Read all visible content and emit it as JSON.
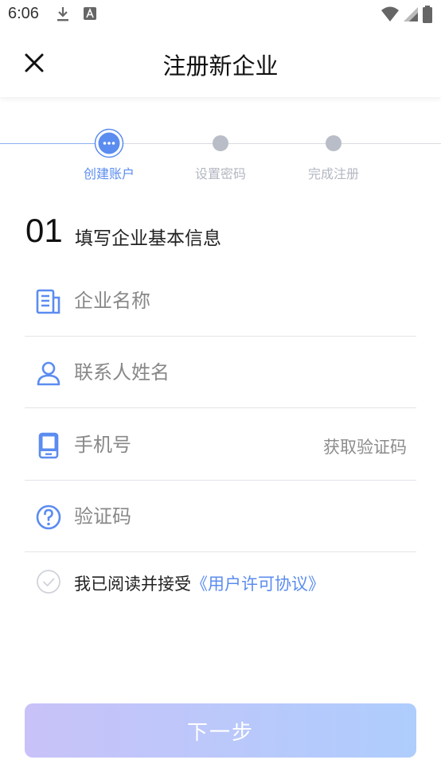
{
  "status_bar": {
    "time": "6:06",
    "icons": [
      "download-icon",
      "font-notification-icon",
      "wifi-icon",
      "signal-icon",
      "battery-icon"
    ]
  },
  "header": {
    "title": "注册新企业",
    "close_icon": "close-icon"
  },
  "stepper": {
    "steps": [
      {
        "label": "创建账户",
        "state": "active"
      },
      {
        "label": "设置密码",
        "state": "pending"
      },
      {
        "label": "完成注册",
        "state": "pending"
      }
    ],
    "active_color": "#5b8cf0",
    "inactive_color": "#b3b7c0"
  },
  "section": {
    "number": "01",
    "title": "填写企业基本信息"
  },
  "form": {
    "company_name": {
      "placeholder": "企业名称",
      "value": "",
      "icon": "document-icon"
    },
    "contact_name": {
      "placeholder": "联系人姓名",
      "value": "",
      "icon": "person-icon"
    },
    "phone": {
      "placeholder": "手机号",
      "value": "",
      "icon": "phone-icon",
      "action": "获取验证码"
    },
    "code": {
      "placeholder": "验证码",
      "value": "",
      "icon": "question-icon"
    }
  },
  "agreement": {
    "text": "我已阅读并接受",
    "link": "《用户许可协议》",
    "checked": false
  },
  "next_button": {
    "label": "下一步",
    "enabled": false
  },
  "colors": {
    "accent": "#5b8cf0",
    "button_gradient_start": "#c8c2f8",
    "button_gradient_end": "#aecdfd"
  }
}
